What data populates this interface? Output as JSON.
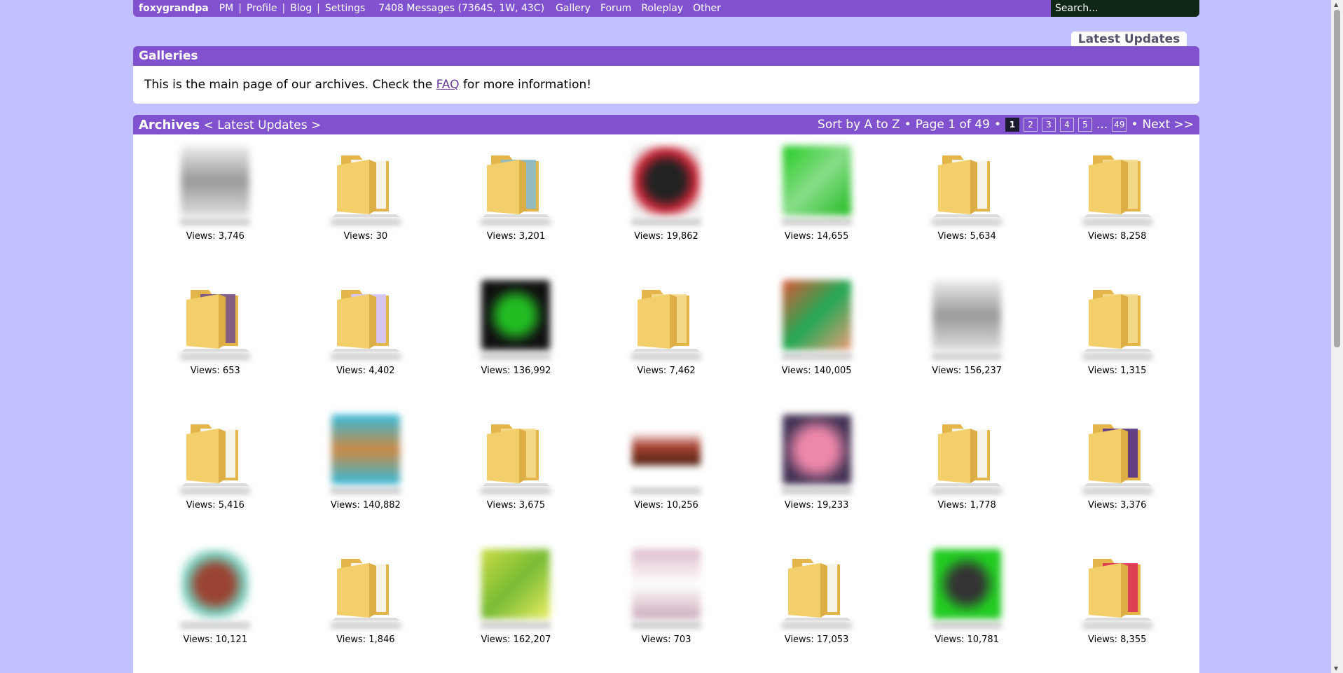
{
  "topbar": {
    "username": "foxygrandpa",
    "links": [
      "PM",
      "Profile",
      "Blog",
      "Settings"
    ],
    "messages": "7408 Messages (7364S, 1W, 43C)",
    "menus": [
      "Gallery",
      "Forum",
      "Roleplay",
      "Other"
    ],
    "search_placeholder": "Search..."
  },
  "latest_tab": "Latest Updates",
  "galleries": {
    "title": "Galleries",
    "text_before": "This is the main page of our archives. Check the",
    "faq_link": "FAQ",
    "text_after": "for more information!"
  },
  "archives": {
    "title": "Archives",
    "nav_prev": "<",
    "nav_label": "Latest Updates",
    "nav_next": ">",
    "sort_label": "Sort by A to Z",
    "bullet": "•",
    "page_info": "Page 1 of 49",
    "pages": [
      "1",
      "2",
      "3",
      "4",
      "5"
    ],
    "ellipsis": "...",
    "last_page": "49",
    "next_label": "Next >>"
  },
  "items": [
    {
      "type": "gray",
      "views": "Views: 3,746"
    },
    {
      "type": "folder",
      "views": "Views: 30"
    },
    {
      "type": "folder-blue",
      "views": "Views: 3,201"
    },
    {
      "type": "dark-red",
      "views": "Views: 19,862"
    },
    {
      "type": "green",
      "views": "Views: 14,655"
    },
    {
      "type": "folder",
      "views": "Views: 5,634"
    },
    {
      "type": "folder-pale",
      "views": "Views: 8,258"
    },
    {
      "type": "folder-purple",
      "views": "Views: 653"
    },
    {
      "type": "folder-lav",
      "views": "Views: 4,402"
    },
    {
      "type": "black-green",
      "views": "Views: 136,992"
    },
    {
      "type": "folder-pale",
      "views": "Views: 7,462"
    },
    {
      "type": "red-green",
      "views": "Views: 140,005"
    },
    {
      "type": "gray",
      "views": "Views: 156,237"
    },
    {
      "type": "folder-pale",
      "views": "Views: 1,315"
    },
    {
      "type": "folder",
      "views": "Views: 5,416"
    },
    {
      "type": "cyan",
      "views": "Views: 140,882"
    },
    {
      "type": "folder-pale",
      "views": "Views: 3,675"
    },
    {
      "type": "brown",
      "views": "Views: 10,256"
    },
    {
      "type": "pink",
      "views": "Views: 19,233"
    },
    {
      "type": "folder",
      "views": "Views: 1,778"
    },
    {
      "type": "folder-violet",
      "views": "Views: 3,376"
    },
    {
      "type": "face",
      "views": "Views: 10,121"
    },
    {
      "type": "folder",
      "views": "Views: 1,846"
    },
    {
      "type": "yellow-green",
      "views": "Views: 162,207"
    },
    {
      "type": "lightpink",
      "views": "Views: 703"
    },
    {
      "type": "folder",
      "views": "Views: 17,053"
    },
    {
      "type": "green-dark",
      "views": "Views: 10,781"
    },
    {
      "type": "folder-red",
      "views": "Views: 8,355"
    }
  ],
  "colors": {
    "page_bg": "#c1c1ff",
    "bar": "#8052cf",
    "search_bg": "#0f2716",
    "folder": "#f2cf6b"
  }
}
